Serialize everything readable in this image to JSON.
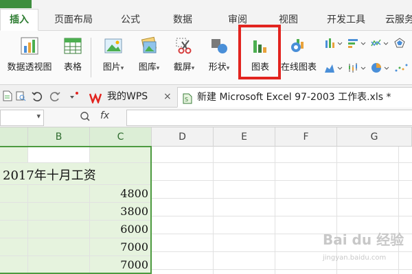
{
  "tabs": [
    {
      "label": "插入",
      "active": true
    },
    {
      "label": "页面布局"
    },
    {
      "label": "公式"
    },
    {
      "label": "数据"
    },
    {
      "label": "审阅"
    },
    {
      "label": "视图"
    },
    {
      "label": "开发工具"
    },
    {
      "label": "云服务"
    }
  ],
  "ribbon": {
    "pivot_label": "数据透视图",
    "table_label": "表格",
    "picture_label": "图片",
    "gallery_label": "图库",
    "screenshot_label": "截屏",
    "shapes_label": "形状",
    "chart_label": "图表",
    "online_chart_label": "在线图表",
    "caret": "▾"
  },
  "doc_tabs": {
    "mywps_label": "我的WPS",
    "file_label": "新建 Microsoft Excel 97-2003 工作表.xls *",
    "close_glyph": "×"
  },
  "formula_bar": {
    "fx_label": "fx",
    "zoom_glyph": "Q",
    "dropdown_glyph": "▾"
  },
  "columns": [
    "B",
    "C",
    "D",
    "E",
    "F",
    "G"
  ],
  "sheet": {
    "title": "2017年十月工资",
    "values": [
      "4800",
      "3800",
      "6000",
      "7000",
      "7000"
    ]
  },
  "colors": {
    "accent": "#2e7d32",
    "highlight": "#e2241f",
    "selection": "#4c9a3f"
  },
  "watermark": {
    "text": "Bai du 经验",
    "sub": "jingyan.baidu.com"
  }
}
